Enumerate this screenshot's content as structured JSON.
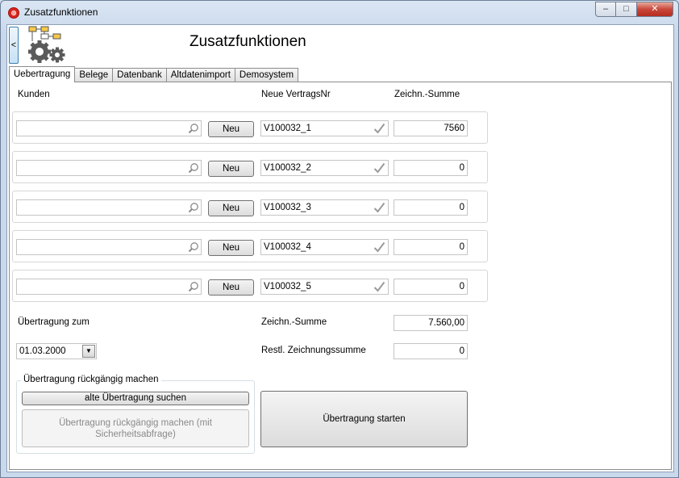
{
  "window": {
    "title": "Zusatzfunktionen",
    "controls": {
      "minimize": "–",
      "maximize": "□",
      "close": "✕"
    }
  },
  "header": {
    "title": "Zusatzfunktionen",
    "back_label": "<",
    "logo_icon": "gears-diagram-icon"
  },
  "tabs": [
    {
      "label": "Uebertragung",
      "active": true
    },
    {
      "label": "Belege"
    },
    {
      "label": "Datenbank"
    },
    {
      "label": "Altdatenimport"
    },
    {
      "label": "Demosystem"
    }
  ],
  "columns": {
    "kunden": "Kunden",
    "vertrag": "Neue VertragsNr",
    "summe": "Zeichn.-Summe"
  },
  "rows": [
    {
      "kunde": "",
      "neu_label": "Neu",
      "vertrag": "V100032_1",
      "summe": "7560"
    },
    {
      "kunde": "",
      "neu_label": "Neu",
      "vertrag": "V100032_2",
      "summe": "0"
    },
    {
      "kunde": "",
      "neu_label": "Neu",
      "vertrag": "V100032_3",
      "summe": "0"
    },
    {
      "kunde": "",
      "neu_label": "Neu",
      "vertrag": "V100032_4",
      "summe": "0"
    },
    {
      "kunde": "",
      "neu_label": "Neu",
      "vertrag": "V100032_5",
      "summe": "0"
    }
  ],
  "uebertragung": {
    "date_label": "Übertragung zum",
    "date_value": "01.03.2000",
    "summe_label": "Zeichn.-Summe",
    "summe_value": "7.560,00",
    "restl_label": "Restl. Zeichnungssumme",
    "restl_value": "0"
  },
  "undo_group": {
    "title": "Übertragung rückgängig machen",
    "search_button": "alte Übertragung suchen",
    "undo_button": "Übertragung rückgängig machen (mit Sicherheitsabfrage)"
  },
  "start_button": "Übertragung starten",
  "colors": {
    "accent": "#3c7fb1",
    "close": "#c9473a",
    "logo_red": "#d9251c"
  }
}
